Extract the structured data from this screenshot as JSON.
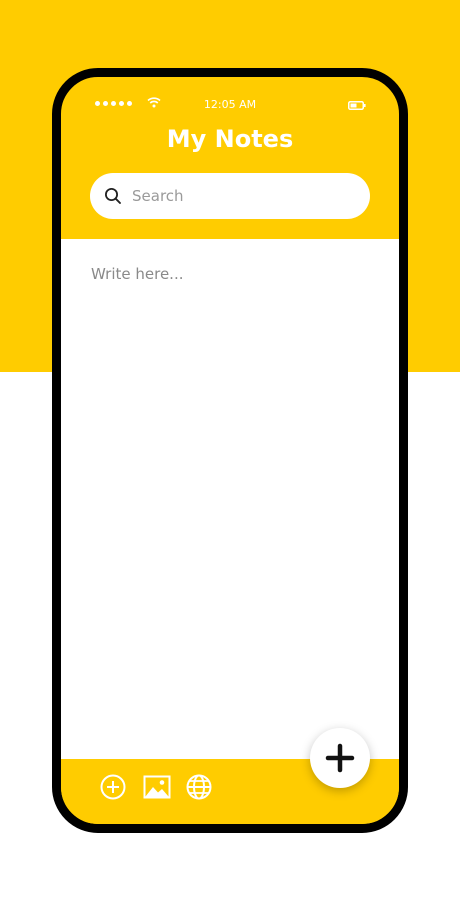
{
  "status_bar": {
    "time": "12:05 AM",
    "signal_icon": "signal-dots-icon",
    "wifi_icon": "wifi-icon",
    "battery_icon": "battery-icon"
  },
  "header": {
    "title": "My Notes"
  },
  "search": {
    "icon": "search-icon",
    "placeholder": "Search"
  },
  "editor": {
    "placeholder": "Write here..."
  },
  "toolbar": {
    "items": [
      {
        "icon": "add-circle-icon"
      },
      {
        "icon": "image-icon"
      },
      {
        "icon": "globe-icon"
      }
    ]
  },
  "fab": {
    "icon": "plus-icon"
  },
  "colors": {
    "accent": "#FFCC00",
    "frame": "#000000",
    "surface": "#FFFFFF"
  }
}
